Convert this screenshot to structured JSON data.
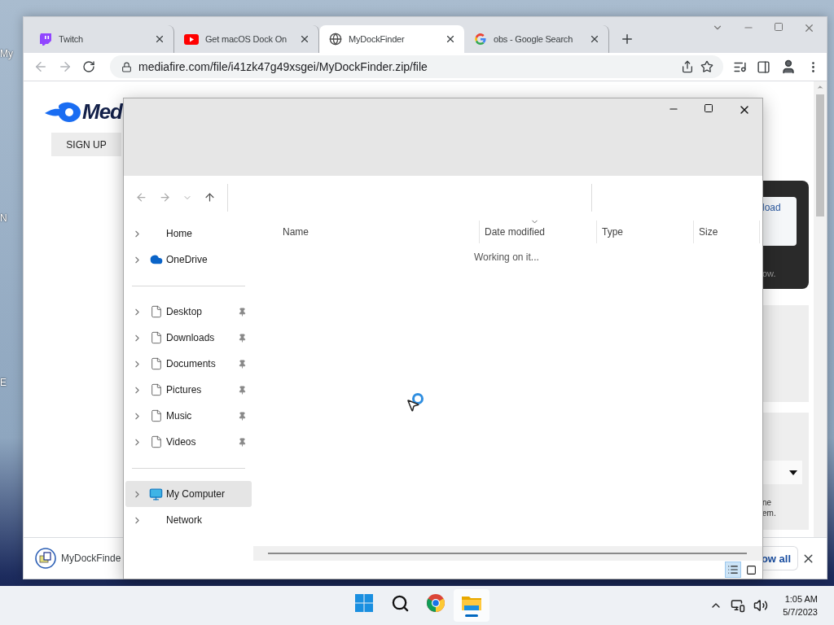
{
  "desktop": {
    "icon_labels": [
      "My",
      "N",
      "E"
    ]
  },
  "browser": {
    "tabs": [
      {
        "title": "Twitch",
        "kind": "twitch",
        "selected": false
      },
      {
        "title": "Get macOS Dock On",
        "kind": "youtube",
        "selected": false
      },
      {
        "title": "MyDockFinder",
        "kind": "globe",
        "selected": true
      },
      {
        "title": "obs - Google Search",
        "kind": "google",
        "selected": false
      }
    ],
    "address": "mediafire.com/file/i41zk47g49xsgei/MyDockFinder.zip/file",
    "page": {
      "logo_text": "Med",
      "sign_up": "SIGN UP",
      "download_button": "load",
      "panel_note": "ow.",
      "form_text": [
        "ne",
        "em."
      ]
    },
    "download_bar": {
      "file_name": "MyDockFinde",
      "show_all": "ow all"
    }
  },
  "explorer": {
    "sidebar_groups": [
      {
        "items": [
          {
            "label": "Home",
            "kind": "plain",
            "selected": false
          },
          {
            "label": "OneDrive",
            "kind": "cloud",
            "selected": false
          }
        ]
      },
      {
        "items": [
          {
            "label": "Desktop",
            "kind": "pinned",
            "selected": false
          },
          {
            "label": "Downloads",
            "kind": "pinned",
            "selected": false
          },
          {
            "label": "Documents",
            "kind": "pinned",
            "selected": false
          },
          {
            "label": "Pictures",
            "kind": "pinned",
            "selected": false
          },
          {
            "label": "Music",
            "kind": "pinned",
            "selected": false
          },
          {
            "label": "Videos",
            "kind": "pinned",
            "selected": false
          }
        ]
      },
      {
        "items": [
          {
            "label": "My Computer",
            "kind": "computer",
            "selected": true
          },
          {
            "label": "Network",
            "kind": "plain",
            "selected": false
          }
        ]
      }
    ],
    "columns": [
      {
        "label": "Name",
        "sorted": false
      },
      {
        "label": "Date modified",
        "sorted": true
      },
      {
        "label": "Type",
        "sorted": false
      },
      {
        "label": "Size",
        "sorted": false
      }
    ],
    "status": "Working on it...",
    "views": [
      {
        "kind": "details",
        "selected": true
      },
      {
        "kind": "tiles",
        "selected": false
      }
    ]
  },
  "taskbar": {
    "apps": [
      {
        "kind": "start",
        "selected": false
      },
      {
        "kind": "search",
        "selected": false
      },
      {
        "kind": "chrome",
        "selected": false
      },
      {
        "kind": "explorer",
        "selected": true
      }
    ],
    "time": "1:05 AM",
    "date": "5/7/2023"
  }
}
